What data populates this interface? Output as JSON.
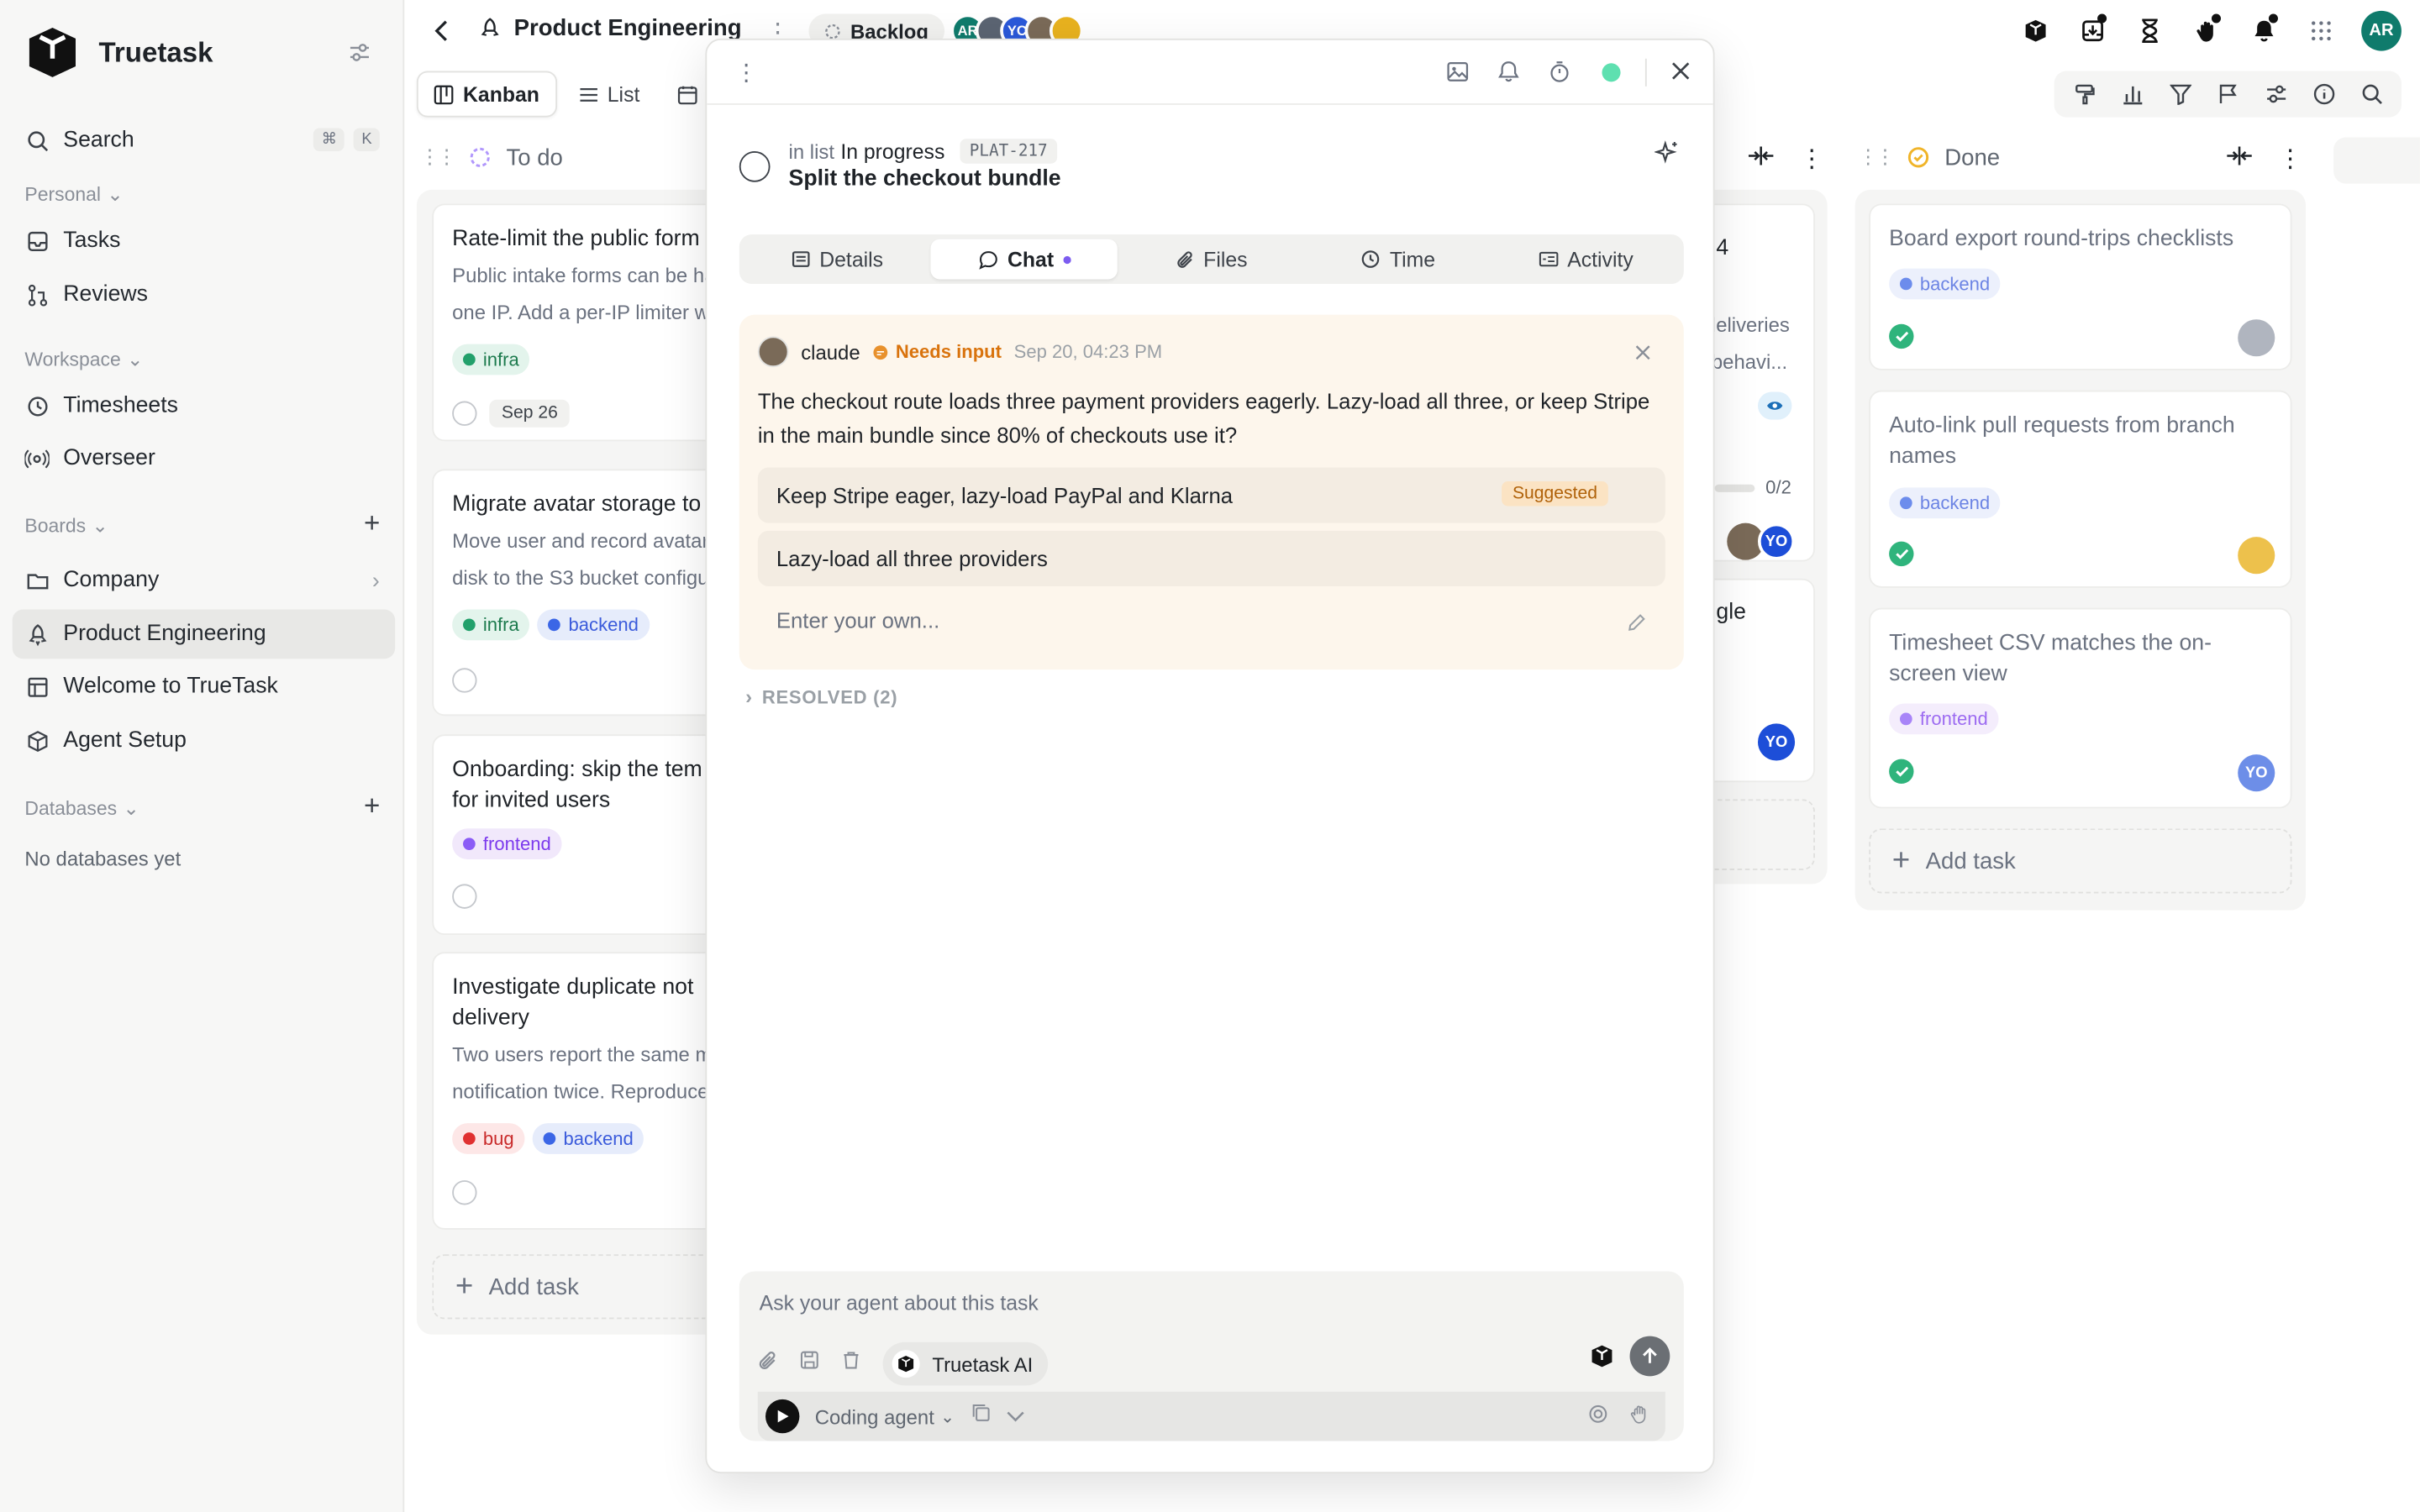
{
  "app": {
    "name": "Truetask"
  },
  "sidebar": {
    "search_label": "Search",
    "search_kbd": [
      "⌘",
      "K"
    ],
    "personal_label": "Personal",
    "personal_items": [
      {
        "label": "Tasks",
        "icon": "inbox-icon"
      },
      {
        "label": "Reviews",
        "icon": "git-pull-request-icon"
      }
    ],
    "workspace_label": "Workspace",
    "workspace_items": [
      {
        "label": "Timesheets",
        "icon": "clock-icon"
      },
      {
        "label": "Overseer",
        "icon": "radar-icon"
      }
    ],
    "boards_label": "Boards",
    "board_items": [
      {
        "label": "Company",
        "icon": "folder-icon",
        "active": false
      },
      {
        "label": "Product Engineering",
        "icon": "rocket-icon",
        "active": true
      },
      {
        "label": "Welcome to TrueTask",
        "icon": "board-icon",
        "active": false
      },
      {
        "label": "Agent Setup",
        "icon": "cube-icon",
        "active": false
      }
    ],
    "databases_label": "Databases",
    "databases_empty": "No databases yet"
  },
  "header": {
    "board_title": "Product Engineering",
    "backlog_label": "Backlog",
    "avatars": [
      {
        "initials": "AR",
        "color": "#0f7b6c"
      },
      {
        "initials": "",
        "color": "#5b6472"
      },
      {
        "initials": "YC",
        "color": "#2b59d9"
      },
      {
        "initials": "",
        "color": "#7a6a58"
      },
      {
        "initials": "",
        "color": "#e8b21f"
      }
    ],
    "user_initials": "AR"
  },
  "view_tabs": [
    {
      "label": "Kanban",
      "active": true
    },
    {
      "label": "List",
      "active": false
    },
    {
      "label": "Ca",
      "active": false
    }
  ],
  "columns": {
    "todo": {
      "title": "To do",
      "cards": [
        {
          "title": "Rate-limit the public form",
          "desc": "Public intake forms can be ha one IP. Add a per-IP limiter wi",
          "tags": [
            "infra"
          ],
          "date": "Sep 26"
        },
        {
          "title": "Migrate avatar storage to",
          "desc": "Move user and record avatars disk to the S3 bucket configu",
          "tags": [
            "infra",
            "backend"
          ]
        },
        {
          "title": "Onboarding: skip the tem for invited users",
          "desc": "",
          "tags": [
            "frontend"
          ]
        },
        {
          "title": "Investigate duplicate not delivery",
          "desc": "Two users report the same m notification twice. Reproduce",
          "tags": [
            "bug",
            "backend"
          ]
        }
      ],
      "add_task": "Add task"
    },
    "inprogress_partial": {
      "c1_title": "4",
      "c1_desc": "leliveries behavi...",
      "c1_progress": "0/2",
      "c2_title": "gle",
      "avatar": "YO"
    },
    "done": {
      "title": "Done",
      "cards": [
        {
          "title": "Board export round-trips checklists",
          "tags": [
            "backend"
          ]
        },
        {
          "title": "Auto-link pull requests from branch names",
          "tags": [
            "backend"
          ]
        },
        {
          "title": "Timesheet CSV matches the on-screen view",
          "tags": [
            "frontend"
          ],
          "avatar": "YO"
        }
      ],
      "add_task": "Add task"
    }
  },
  "modal": {
    "in_list_prefix": "in list",
    "list_name": "In progress",
    "task_id": "PLAT-217",
    "task_title": "Split the checkout bundle",
    "tabs": [
      {
        "label": "Details",
        "icon": "doc-icon",
        "active": false
      },
      {
        "label": "Chat",
        "icon": "chat-icon",
        "active": true
      },
      {
        "label": "Files",
        "icon": "paperclip-icon",
        "active": false
      },
      {
        "label": "Time",
        "icon": "clock-icon",
        "active": false
      },
      {
        "label": "Activity",
        "icon": "activity-icon",
        "active": false
      }
    ],
    "message": {
      "author": "claude",
      "status": "Needs input",
      "time": "Sep 20, 04:23 PM",
      "body": "The checkout route loads three payment providers eagerly. Lazy-load all three, or keep Stripe in the main bundle since 80% of checkouts use it?",
      "options": [
        {
          "label": "Keep Stripe eager, lazy-load PayPal and Klarna",
          "badge": "Suggested"
        },
        {
          "label": "Lazy-load all three providers",
          "badge": ""
        }
      ],
      "custom_placeholder": "Enter your own..."
    },
    "resolved_label": "RESOLVED (2)",
    "composer": {
      "placeholder": "Ask your agent about this task",
      "ai_label": "Truetask AI",
      "agent_label": "Coding agent"
    }
  },
  "colors": {
    "accent": "#0f7b6c",
    "needs_input": "#d9730d",
    "status_dot": "#5ee0b0"
  }
}
